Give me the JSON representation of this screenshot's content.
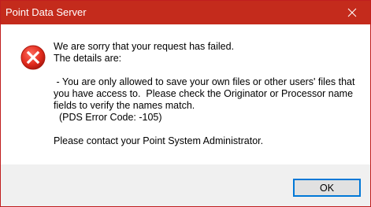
{
  "window": {
    "title": "Point Data Server",
    "title_bar_color": "#c42b1c",
    "close_icon": "close-icon"
  },
  "dialog": {
    "icon": "error-icon",
    "icon_color": "#e81123",
    "line1": "We are sorry that your request has failed.",
    "line2": "The details are:",
    "detail_line1": " - You are only allowed to save your own files or other users' files that you have access to.  Please check the Originator or Processor name fields to verify the names match.",
    "detail_line2": "  (PDS Error Code: -105)",
    "contact": "Please contact your Point System Administrator."
  },
  "buttons": {
    "ok_label": "OK"
  }
}
